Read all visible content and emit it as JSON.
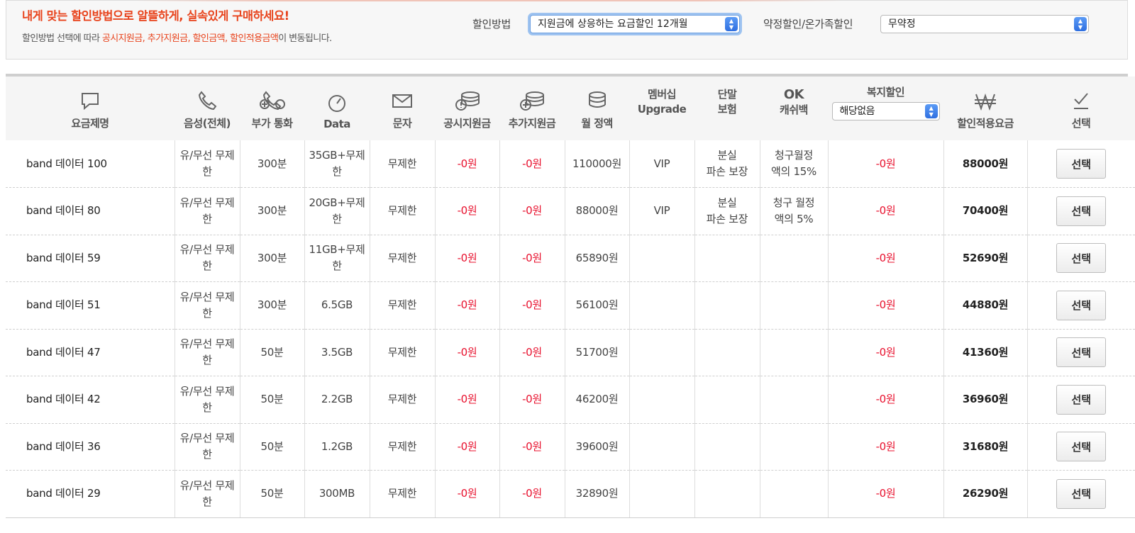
{
  "banner": {
    "headline": "내게 맞는 할인방법으로 알뜰하게, 실속있게 구매하세요!",
    "sub_prefix": "할인방법 선택에 따라 ",
    "sub_highlight": "공시지원금, 추가지원금, 할인금액, 할인적용금액",
    "sub_suffix": "이 변동됩니다."
  },
  "filters": {
    "discount_method_label": "할인방법",
    "discount_method_value": "지원금에 상응하는 요금할인 12개월",
    "contract_label": "약정할인/온가족할인",
    "contract_value": "무약정"
  },
  "headers": {
    "plan": "요금제명",
    "voice": "음성(전체)",
    "extra_call": "부가 통화",
    "data": "Data",
    "sms": "문자",
    "public_subsidy": "공시지원금",
    "extra_subsidy": "추가지원금",
    "monthly": "월 정액",
    "membership_line1": "멤버십",
    "membership_line2": "Upgrade",
    "insurance_line1": "단말",
    "insurance_line2": "보험",
    "ok_line1": "OK",
    "ok_line2": "캐쉬백",
    "welfare": "복지할인",
    "welfare_value": "해당없음",
    "final_price": "할인적용요금",
    "select": "선택"
  },
  "icons": {
    "plan": "chat-bubble-icon",
    "voice": "phone-icon",
    "extra_call": "multi-phone-icon",
    "data": "gauge-icon",
    "sms": "envelope-icon",
    "public_subsidy": "coins-info-icon",
    "extra_subsidy": "coins-plus-icon",
    "monthly": "coin-stack-icon",
    "final_price": "won-icon",
    "select": "checkmark-icon"
  },
  "rows": [
    {
      "plan": "band 데이터 100",
      "voice": "유/무선 무제한",
      "extra": "300분",
      "data": "35GB+무제한",
      "sms": "무제한",
      "public": "-0원",
      "extra_sub": "-0원",
      "monthly": "110000원",
      "membership": "VIP",
      "insurance": "분실\n파손 보장",
      "ok": "청구월정\n액의 15%",
      "welfare": "-0원",
      "final": "88000원",
      "button": "선택"
    },
    {
      "plan": "band 데이터 80",
      "voice": "유/무선 무제한",
      "extra": "300분",
      "data": "20GB+무제한",
      "sms": "무제한",
      "public": "-0원",
      "extra_sub": "-0원",
      "monthly": "88000원",
      "membership": "VIP",
      "insurance": "분실\n파손 보장",
      "ok": "청구 월정\n액의 5%",
      "welfare": "-0원",
      "final": "70400원",
      "button": "선택"
    },
    {
      "plan": "band 데이터 59",
      "voice": "유/무선 무제한",
      "extra": "300분",
      "data": "11GB+무제한",
      "sms": "무제한",
      "public": "-0원",
      "extra_sub": "-0원",
      "monthly": "65890원",
      "membership": "",
      "insurance": "",
      "ok": "",
      "welfare": "-0원",
      "final": "52690원",
      "button": "선택"
    },
    {
      "plan": "band 데이터 51",
      "voice": "유/무선 무제한",
      "extra": "300분",
      "data": "6.5GB",
      "sms": "무제한",
      "public": "-0원",
      "extra_sub": "-0원",
      "monthly": "56100원",
      "membership": "",
      "insurance": "",
      "ok": "",
      "welfare": "-0원",
      "final": "44880원",
      "button": "선택"
    },
    {
      "plan": "band 데이터 47",
      "voice": "유/무선 무제한",
      "extra": "50분",
      "data": "3.5GB",
      "sms": "무제한",
      "public": "-0원",
      "extra_sub": "-0원",
      "monthly": "51700원",
      "membership": "",
      "insurance": "",
      "ok": "",
      "welfare": "-0원",
      "final": "41360원",
      "button": "선택"
    },
    {
      "plan": "band 데이터 42",
      "voice": "유/무선 무제한",
      "extra": "50분",
      "data": "2.2GB",
      "sms": "무제한",
      "public": "-0원",
      "extra_sub": "-0원",
      "monthly": "46200원",
      "membership": "",
      "insurance": "",
      "ok": "",
      "welfare": "-0원",
      "final": "36960원",
      "button": "선택"
    },
    {
      "plan": "band 데이터 36",
      "voice": "유/무선 무제한",
      "extra": "50분",
      "data": "1.2GB",
      "sms": "무제한",
      "public": "-0원",
      "extra_sub": "-0원",
      "monthly": "39600원",
      "membership": "",
      "insurance": "",
      "ok": "",
      "welfare": "-0원",
      "final": "31680원",
      "button": "선택"
    },
    {
      "plan": "band 데이터 29",
      "voice": "유/무선 무제한",
      "extra": "50분",
      "data": "300MB",
      "sms": "무제한",
      "public": "-0원",
      "extra_sub": "-0원",
      "monthly": "32890원",
      "membership": "",
      "insurance": "",
      "ok": "",
      "welfare": "-0원",
      "final": "26290원",
      "button": "선택"
    }
  ]
}
